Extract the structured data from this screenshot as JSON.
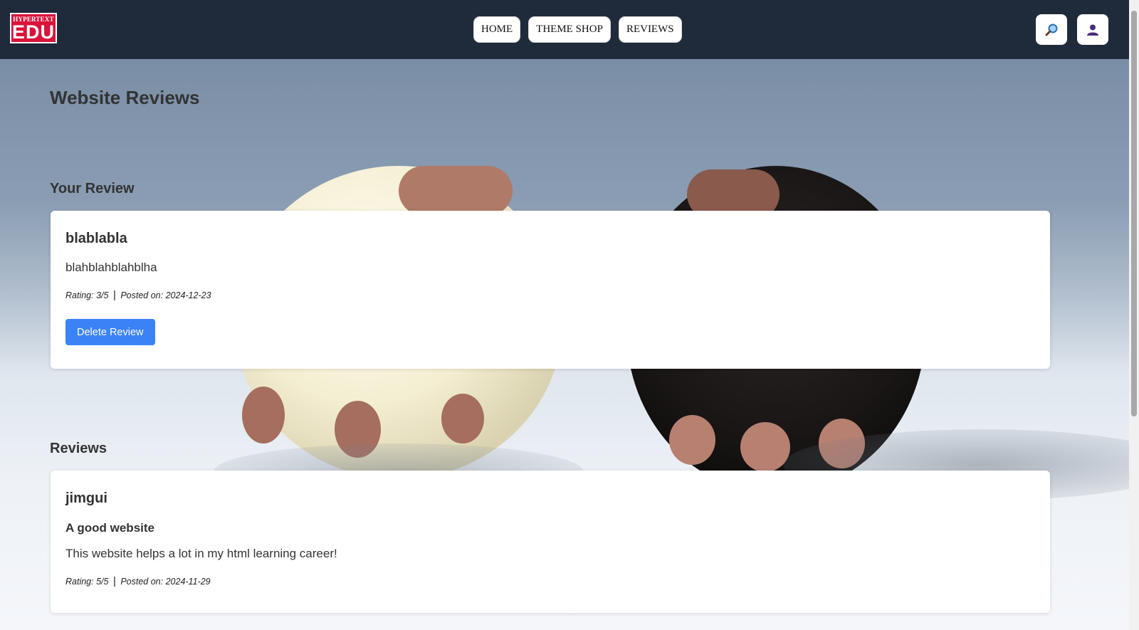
{
  "header": {
    "logo_top": "HYPERTEXT",
    "logo_main": "EDU",
    "nav": [
      {
        "label": "HOME"
      },
      {
        "label": "THEME SHOP"
      },
      {
        "label": "REVIEWS"
      }
    ],
    "search_icon": "magnifier-icon",
    "user_icon": "user-icon"
  },
  "page": {
    "title": "Website Reviews"
  },
  "your_review": {
    "heading": "Your Review",
    "author": "blablabla",
    "body": "blahblahblahblha",
    "rating_text": "Rating: 3/5",
    "separator": "|",
    "posted_text": "Posted on: 2024-12-23",
    "delete_label": "Delete Review"
  },
  "reviews": {
    "heading": "Reviews",
    "items": [
      {
        "author": "jimgui",
        "title": "A good website",
        "body": "This website helps a lot in my html learning career!",
        "rating_text": "Rating: 5/5",
        "separator": "|",
        "posted_text": "Posted on: 2024-11-29"
      }
    ]
  },
  "colors": {
    "header_bg": "#1f2a3b",
    "accent_button": "#3b82f6",
    "logo_red": "#d9143a"
  }
}
